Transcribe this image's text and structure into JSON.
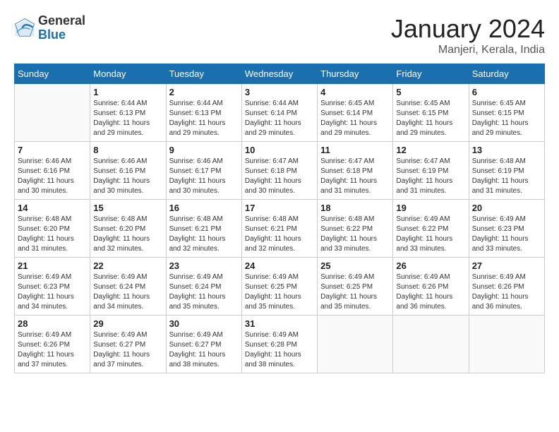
{
  "logo": {
    "general": "General",
    "blue": "Blue"
  },
  "title": "January 2024",
  "location": "Manjeri, Kerala, India",
  "days_of_week": [
    "Sunday",
    "Monday",
    "Tuesday",
    "Wednesday",
    "Thursday",
    "Friday",
    "Saturday"
  ],
  "weeks": [
    [
      {
        "day": "",
        "sunrise": "",
        "sunset": "",
        "daylight": ""
      },
      {
        "day": "1",
        "sunrise": "Sunrise: 6:44 AM",
        "sunset": "Sunset: 6:13 PM",
        "daylight": "Daylight: 11 hours and 29 minutes."
      },
      {
        "day": "2",
        "sunrise": "Sunrise: 6:44 AM",
        "sunset": "Sunset: 6:13 PM",
        "daylight": "Daylight: 11 hours and 29 minutes."
      },
      {
        "day": "3",
        "sunrise": "Sunrise: 6:44 AM",
        "sunset": "Sunset: 6:14 PM",
        "daylight": "Daylight: 11 hours and 29 minutes."
      },
      {
        "day": "4",
        "sunrise": "Sunrise: 6:45 AM",
        "sunset": "Sunset: 6:14 PM",
        "daylight": "Daylight: 11 hours and 29 minutes."
      },
      {
        "day": "5",
        "sunrise": "Sunrise: 6:45 AM",
        "sunset": "Sunset: 6:15 PM",
        "daylight": "Daylight: 11 hours and 29 minutes."
      },
      {
        "day": "6",
        "sunrise": "Sunrise: 6:45 AM",
        "sunset": "Sunset: 6:15 PM",
        "daylight": "Daylight: 11 hours and 29 minutes."
      }
    ],
    [
      {
        "day": "7",
        "sunrise": "Sunrise: 6:46 AM",
        "sunset": "Sunset: 6:16 PM",
        "daylight": "Daylight: 11 hours and 30 minutes."
      },
      {
        "day": "8",
        "sunrise": "Sunrise: 6:46 AM",
        "sunset": "Sunset: 6:16 PM",
        "daylight": "Daylight: 11 hours and 30 minutes."
      },
      {
        "day": "9",
        "sunrise": "Sunrise: 6:46 AM",
        "sunset": "Sunset: 6:17 PM",
        "daylight": "Daylight: 11 hours and 30 minutes."
      },
      {
        "day": "10",
        "sunrise": "Sunrise: 6:47 AM",
        "sunset": "Sunset: 6:18 PM",
        "daylight": "Daylight: 11 hours and 30 minutes."
      },
      {
        "day": "11",
        "sunrise": "Sunrise: 6:47 AM",
        "sunset": "Sunset: 6:18 PM",
        "daylight": "Daylight: 11 hours and 31 minutes."
      },
      {
        "day": "12",
        "sunrise": "Sunrise: 6:47 AM",
        "sunset": "Sunset: 6:19 PM",
        "daylight": "Daylight: 11 hours and 31 minutes."
      },
      {
        "day": "13",
        "sunrise": "Sunrise: 6:48 AM",
        "sunset": "Sunset: 6:19 PM",
        "daylight": "Daylight: 11 hours and 31 minutes."
      }
    ],
    [
      {
        "day": "14",
        "sunrise": "Sunrise: 6:48 AM",
        "sunset": "Sunset: 6:20 PM",
        "daylight": "Daylight: 11 hours and 31 minutes."
      },
      {
        "day": "15",
        "sunrise": "Sunrise: 6:48 AM",
        "sunset": "Sunset: 6:20 PM",
        "daylight": "Daylight: 11 hours and 32 minutes."
      },
      {
        "day": "16",
        "sunrise": "Sunrise: 6:48 AM",
        "sunset": "Sunset: 6:21 PM",
        "daylight": "Daylight: 11 hours and 32 minutes."
      },
      {
        "day": "17",
        "sunrise": "Sunrise: 6:48 AM",
        "sunset": "Sunset: 6:21 PM",
        "daylight": "Daylight: 11 hours and 32 minutes."
      },
      {
        "day": "18",
        "sunrise": "Sunrise: 6:48 AM",
        "sunset": "Sunset: 6:22 PM",
        "daylight": "Daylight: 11 hours and 33 minutes."
      },
      {
        "day": "19",
        "sunrise": "Sunrise: 6:49 AM",
        "sunset": "Sunset: 6:22 PM",
        "daylight": "Daylight: 11 hours and 33 minutes."
      },
      {
        "day": "20",
        "sunrise": "Sunrise: 6:49 AM",
        "sunset": "Sunset: 6:23 PM",
        "daylight": "Daylight: 11 hours and 33 minutes."
      }
    ],
    [
      {
        "day": "21",
        "sunrise": "Sunrise: 6:49 AM",
        "sunset": "Sunset: 6:23 PM",
        "daylight": "Daylight: 11 hours and 34 minutes."
      },
      {
        "day": "22",
        "sunrise": "Sunrise: 6:49 AM",
        "sunset": "Sunset: 6:24 PM",
        "daylight": "Daylight: 11 hours and 34 minutes."
      },
      {
        "day": "23",
        "sunrise": "Sunrise: 6:49 AM",
        "sunset": "Sunset: 6:24 PM",
        "daylight": "Daylight: 11 hours and 35 minutes."
      },
      {
        "day": "24",
        "sunrise": "Sunrise: 6:49 AM",
        "sunset": "Sunset: 6:25 PM",
        "daylight": "Daylight: 11 hours and 35 minutes."
      },
      {
        "day": "25",
        "sunrise": "Sunrise: 6:49 AM",
        "sunset": "Sunset: 6:25 PM",
        "daylight": "Daylight: 11 hours and 35 minutes."
      },
      {
        "day": "26",
        "sunrise": "Sunrise: 6:49 AM",
        "sunset": "Sunset: 6:26 PM",
        "daylight": "Daylight: 11 hours and 36 minutes."
      },
      {
        "day": "27",
        "sunrise": "Sunrise: 6:49 AM",
        "sunset": "Sunset: 6:26 PM",
        "daylight": "Daylight: 11 hours and 36 minutes."
      }
    ],
    [
      {
        "day": "28",
        "sunrise": "Sunrise: 6:49 AM",
        "sunset": "Sunset: 6:26 PM",
        "daylight": "Daylight: 11 hours and 37 minutes."
      },
      {
        "day": "29",
        "sunrise": "Sunrise: 6:49 AM",
        "sunset": "Sunset: 6:27 PM",
        "daylight": "Daylight: 11 hours and 37 minutes."
      },
      {
        "day": "30",
        "sunrise": "Sunrise: 6:49 AM",
        "sunset": "Sunset: 6:27 PM",
        "daylight": "Daylight: 11 hours and 38 minutes."
      },
      {
        "day": "31",
        "sunrise": "Sunrise: 6:49 AM",
        "sunset": "Sunset: 6:28 PM",
        "daylight": "Daylight: 11 hours and 38 minutes."
      },
      {
        "day": "",
        "sunrise": "",
        "sunset": "",
        "daylight": ""
      },
      {
        "day": "",
        "sunrise": "",
        "sunset": "",
        "daylight": ""
      },
      {
        "day": "",
        "sunrise": "",
        "sunset": "",
        "daylight": ""
      }
    ]
  ]
}
